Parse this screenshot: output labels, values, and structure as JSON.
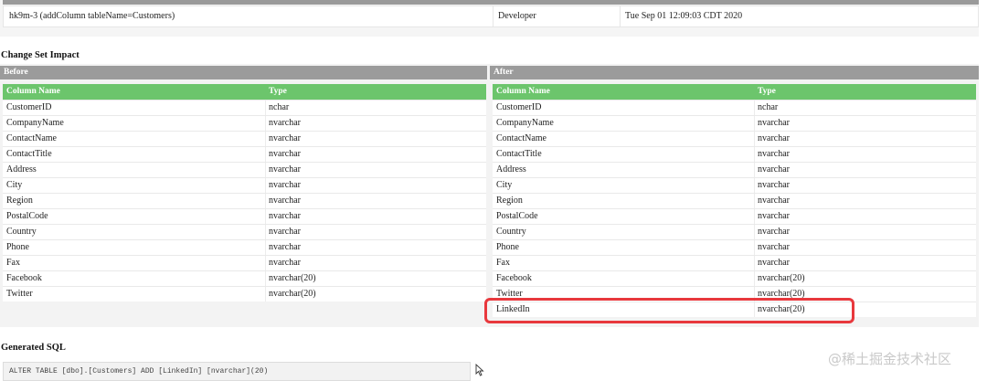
{
  "changeset": {
    "id": "hk9m-3 (addColumn tableName=Customers)",
    "author": "Developer",
    "date": "Tue Sep 01 12:09:03 CDT 2020"
  },
  "impact": {
    "title": "Change Set Impact",
    "before": {
      "header": "Before",
      "col_name": "Column Name",
      "col_type": "Type",
      "rows": [
        {
          "name": "CustomerID",
          "type": "nchar"
        },
        {
          "name": "CompanyName",
          "type": "nvarchar"
        },
        {
          "name": "ContactName",
          "type": "nvarchar"
        },
        {
          "name": "ContactTitle",
          "type": "nvarchar"
        },
        {
          "name": "Address",
          "type": "nvarchar"
        },
        {
          "name": "City",
          "type": "nvarchar"
        },
        {
          "name": "Region",
          "type": "nvarchar"
        },
        {
          "name": "PostalCode",
          "type": "nvarchar"
        },
        {
          "name": "Country",
          "type": "nvarchar"
        },
        {
          "name": "Phone",
          "type": "nvarchar"
        },
        {
          "name": "Fax",
          "type": "nvarchar"
        },
        {
          "name": "Facebook",
          "type": "nvarchar(20)"
        },
        {
          "name": "Twitter",
          "type": "nvarchar(20)"
        }
      ]
    },
    "after": {
      "header": "After",
      "col_name": "Column Name",
      "col_type": "Type",
      "rows": [
        {
          "name": "CustomerID",
          "type": "nchar"
        },
        {
          "name": "CompanyName",
          "type": "nvarchar"
        },
        {
          "name": "ContactName",
          "type": "nvarchar"
        },
        {
          "name": "ContactTitle",
          "type": "nvarchar"
        },
        {
          "name": "Address",
          "type": "nvarchar"
        },
        {
          "name": "City",
          "type": "nvarchar"
        },
        {
          "name": "Region",
          "type": "nvarchar"
        },
        {
          "name": "PostalCode",
          "type": "nvarchar"
        },
        {
          "name": "Country",
          "type": "nvarchar"
        },
        {
          "name": "Phone",
          "type": "nvarchar"
        },
        {
          "name": "Fax",
          "type": "nvarchar"
        },
        {
          "name": "Facebook",
          "type": "nvarchar(20)"
        },
        {
          "name": "Twitter",
          "type": "nvarchar(20)"
        },
        {
          "name": "LinkedIn",
          "type": "nvarchar(20)"
        }
      ]
    }
  },
  "sql": {
    "title": "Generated SQL",
    "statement": "ALTER TABLE [dbo].[Customers] ADD [LinkedIn] [nvarchar](20)"
  },
  "watermark": "@稀土掘金技术社区",
  "colors": {
    "header_gray": "#9b9b9b",
    "column_header_green": "#6cc56c",
    "highlight_red": "#e8383d"
  }
}
